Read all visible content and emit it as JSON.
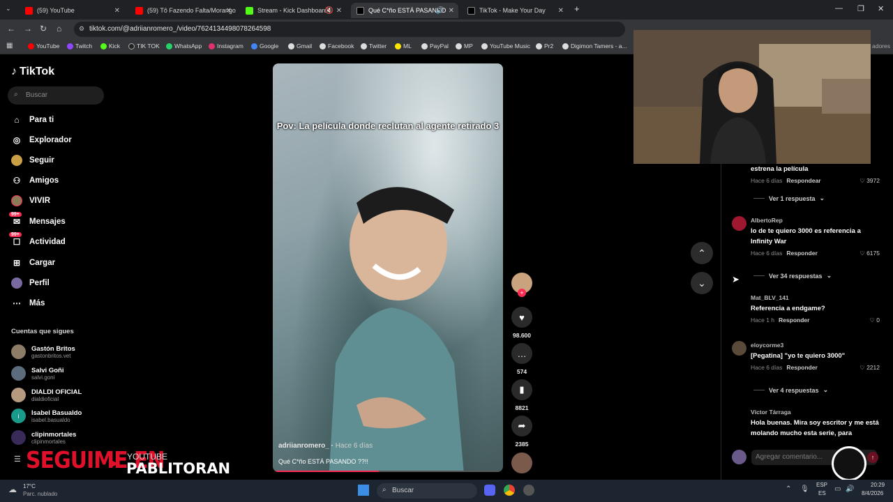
{
  "browser": {
    "tabs": [
      {
        "label": "(59) YouTube",
        "color": "#ff0000"
      },
      {
        "label": "(59) Tô Fazendo Falta/Morango",
        "color": "#ff0000"
      },
      {
        "label": "Stream - Kick Dashboard",
        "color": "#53fc18"
      },
      {
        "label": "Qué C*ño ESTÁ PASANDO",
        "color": "#ffffff"
      },
      {
        "label": "TikTok - Make Your Day",
        "color": "#ffffff"
      }
    ],
    "url": "tiktok.com/@adriianromero_/video/7624134498078264598",
    "bookmarks": [
      "YouTube",
      "Twitch",
      "Kick",
      "TIK TOK",
      "WhatsApp",
      "Instagram",
      "Google",
      "Gmail",
      "Facebook",
      "Twitter",
      "ML",
      "PayPal",
      "MP",
      "YouTube Music",
      "Pr2",
      "Digimon Tamers - a..."
    ],
    "bookmarks_overflow": "adores"
  },
  "tiktok": {
    "logo": "TikTok",
    "search_placeholder": "Buscar",
    "nav": [
      "Para ti",
      "Explorador",
      "Seguir",
      "Amigos",
      "VIVIR",
      "Mensajes",
      "Actividad",
      "Cargar",
      "Perfil",
      "Más"
    ],
    "badge": "99+",
    "following_title": "Cuentas que sigues",
    "following": [
      {
        "name": "Gastón Britos",
        "handle": "gastonbritos.vet"
      },
      {
        "name": "Salvi Goñi",
        "handle": "salvi.goni"
      },
      {
        "name": "DIALDI OFICIAL",
        "handle": "dialdioficial"
      },
      {
        "name": "Isabel Basualdo",
        "handle": "isabel.basualdo"
      },
      {
        "name": "clipinmortales",
        "handle": "clipinmortales"
      }
    ]
  },
  "video": {
    "caption": "Pov: La película donde reclutan al agente retirado 3",
    "author": "adriianromero_",
    "posted": "Hace 6 días",
    "description": "Qué C*ño ESTÁ PASANDO ??!!",
    "progress_pct": 46,
    "likes": "98.600",
    "comments": "574",
    "saves": "8821",
    "shares": "2385"
  },
  "comments": {
    "top_partial_text": "estrena la película",
    "top_partial_meta": {
      "time": "Hace 6 días",
      "reply": "Respondear",
      "likes": "3972"
    },
    "top_more": "Ver 1 respuesta",
    "items": [
      {
        "user": "AlbertoRep",
        "text": "lo de te quiero 3000 es referencia a Infinity War",
        "time": "Hace 6 días",
        "reply": "Responder",
        "likes": "6175",
        "more": "Ver 34 respuestas"
      },
      {
        "user": "Mat_BLV_141",
        "text": "Referencia a endgame?",
        "time": "Hace 1 h",
        "reply": "Responder",
        "likes": "0",
        "more": ""
      },
      {
        "user": "eloycorme3",
        "text": "[Pegatina] \"yo te quiero 3000\"",
        "time": "Hace 6 días",
        "reply": "Responder",
        "likes": "2212",
        "more": "Ver 4 respuestas"
      },
      {
        "user": "Víctor Tárraga",
        "text": "Hola buenas. Mira soy escritor y me está molando mucho esta serie, para",
        "time": "",
        "reply": "",
        "likes": "",
        "more": ""
      }
    ],
    "add_placeholder": "Agregar comentario..."
  },
  "overlay": {
    "seguime": "SEGUIME EN",
    "platform": "YOUTUBE",
    "channel": "PABLITORAN"
  },
  "taskbar": {
    "weather_temp": "17°C",
    "weather_desc": "Parc. nublado",
    "search": "Buscar",
    "lang1": "ESP",
    "lang2": "ES",
    "time": "20:29",
    "date": "8/4/2026"
  }
}
